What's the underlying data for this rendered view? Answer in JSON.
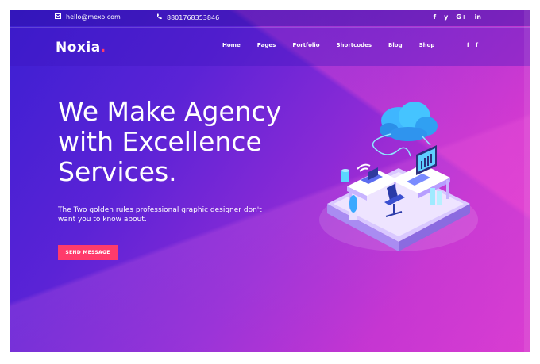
{
  "topbar": {
    "email": "hello@mexo.com",
    "phone": "8801768353846",
    "social": [
      "f",
      "y",
      "G+",
      "in"
    ]
  },
  "nav": {
    "logo_text": "Noxia",
    "logo_dot": ".",
    "menu": [
      "Home",
      "Pages",
      "Portfolio",
      "Shortcodes",
      "Blog",
      "Shop"
    ],
    "social": [
      "f",
      "f"
    ]
  },
  "hero": {
    "title_lines": [
      "We Make Agency",
      "with Excellence",
      "Services."
    ],
    "subtitle_lines": [
      "The Two golden rules professional graphic designer don't",
      "want you to know about."
    ],
    "button": "SEND MESSAGE"
  },
  "colors": {
    "accent": "#ff3b6b",
    "gradient_start": "#3b1fd2",
    "gradient_end": "#d83ad0"
  },
  "icons": {
    "email": "envelope-icon",
    "phone": "phone-icon"
  }
}
